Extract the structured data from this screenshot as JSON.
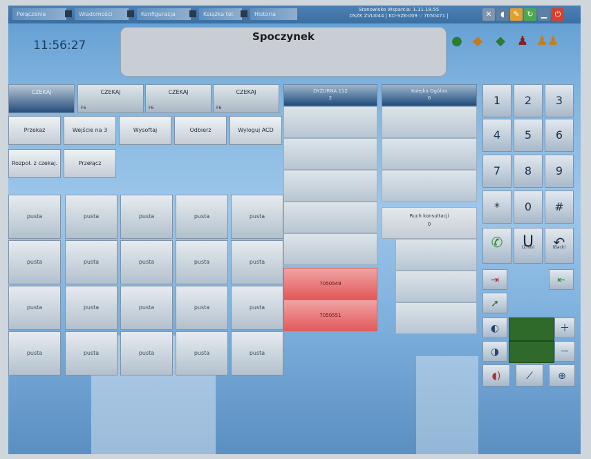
{
  "topbar": {
    "tabs": [
      "Połączenia",
      "Wiadomości",
      "Konfiguracja",
      "Książka tel.",
      "Historia"
    ],
    "stanowisko_line1": "Stanowisko Wsparcia: 1.11.18.55",
    "stanowisko_line2": "DSZK ZVLI044 | KD-SZK-009 :: 7050471 |"
  },
  "header": {
    "clock": "11:56:27",
    "status": "Spoczynek"
  },
  "wait_buttons": [
    {
      "label": "CZEKAJ",
      "sub": ""
    },
    {
      "label": "CZEKAJ",
      "sub": "F6"
    },
    {
      "label": "CZEKAJ",
      "sub": "F6"
    },
    {
      "label": "CZEKAJ",
      "sub": "F6"
    }
  ],
  "action_buttons_row1": [
    "Przekaz",
    "Wejście na 3",
    "Wysoftaj",
    "Odbierz",
    "Wyloguj ACD"
  ],
  "action_buttons_row2": [
    "Rozpoł. z czekaj.",
    "Przełącz"
  ],
  "speed_dial": {
    "empty_label": "pusta",
    "rows": [
      [
        "pusta",
        "pusta",
        "pusta",
        "pusta",
        "pusta"
      ],
      [
        "pusta",
        "pusta",
        "pusta",
        "pusta",
        "pusta"
      ],
      [
        "pusta",
        "pusta",
        "pusta",
        "pusta",
        "pusta"
      ],
      [
        "pusta",
        "pusta",
        "pusta",
        "pusta",
        "pusta"
      ]
    ]
  },
  "queue1": {
    "header": "DYŻURNA 112",
    "count": "2",
    "calls": [
      "7050549",
      "7050551"
    ]
  },
  "queue2": {
    "header": "Kolejka Ogólna",
    "count": "0",
    "consult_label": "Ruch konsultacji",
    "consult_count": "0"
  },
  "keypad": {
    "keys": [
      "1",
      "2",
      "3",
      "4",
      "5",
      "6",
      "7",
      "8",
      "9",
      "*",
      "0",
      "#"
    ],
    "hold_label": "(Zmb)",
    "back_label": "(Back)"
  },
  "colors": {
    "call_red": "#e35a5a",
    "header_blue": "#1f4c7d",
    "green_box": "#2f6a2a"
  }
}
